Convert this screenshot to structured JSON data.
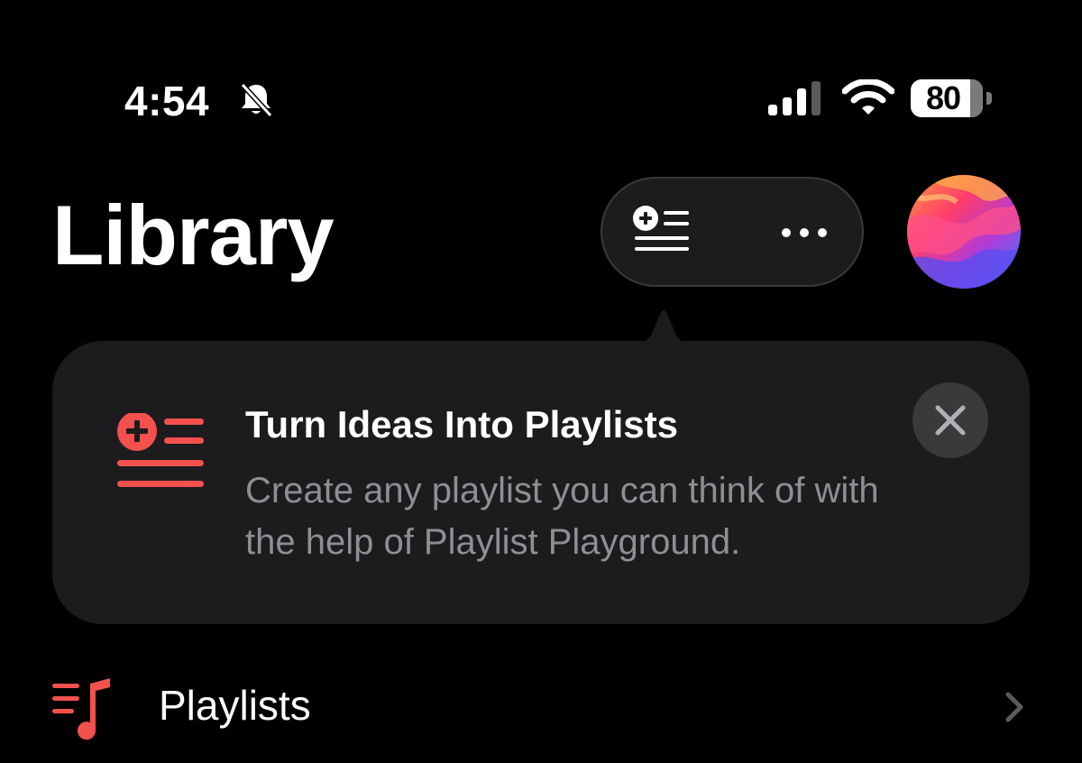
{
  "status_bar": {
    "time": "4:54",
    "battery_level": "80",
    "icons": [
      "bell-slash-icon",
      "cellular-signal-icon",
      "wifi-icon",
      "battery-icon"
    ]
  },
  "header": {
    "title": "Library",
    "toolbar_icons": [
      "add-playlist-icon",
      "more-ellipsis-icon"
    ],
    "avatar_icon": "profile-avatar"
  },
  "tip": {
    "title": "Turn Ideas Into Playlists",
    "body": "Create any playlist you can think of with the help of Playlist Playground.",
    "icon": "add-playlist-icon",
    "close_icon": "close-icon"
  },
  "library_rows": [
    {
      "label": "Playlists",
      "icon": "playlist-music-icon"
    }
  ],
  "colors": {
    "background": "#000000",
    "surface": "#1c1c1e",
    "accent_red": "#f2514d",
    "secondary_text": "#8e8e93",
    "close_button": "#3a3a3c"
  }
}
